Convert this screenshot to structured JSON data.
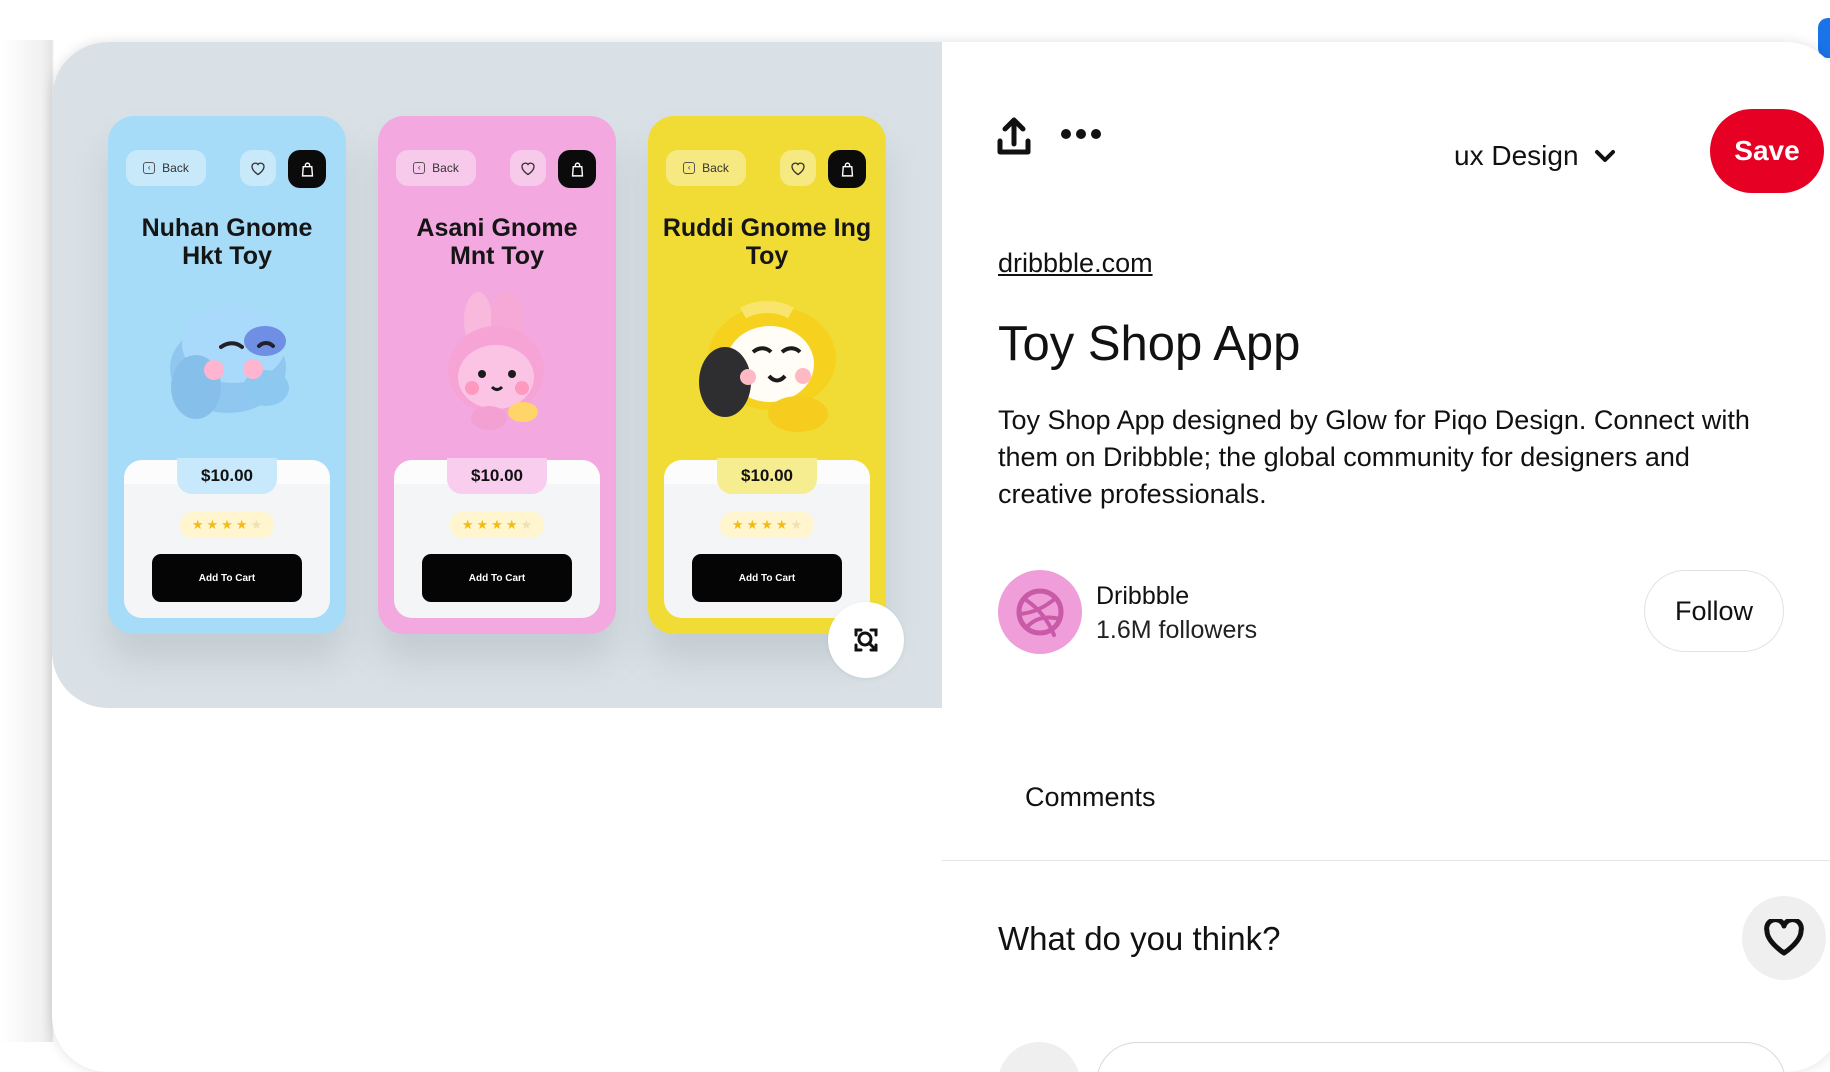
{
  "image": {
    "screens": [
      {
        "back_label": "Back",
        "title": "Nuhan Gnome Hkt Toy",
        "price": "$10.00",
        "rating": 4,
        "cart_label": "Add To Cart",
        "color": "#a6dcf7"
      },
      {
        "back_label": "Back",
        "title": "Asani Gnome Mnt Toy",
        "price": "$10.00",
        "rating": 4,
        "cart_label": "Add To Cart",
        "color": "#f3a8df"
      },
      {
        "back_label": "Back",
        "title": "Ruddi Gnome Ing Toy",
        "price": "$10.00",
        "rating": 4,
        "cart_label": "Add To Cart",
        "color": "#f1dc35"
      }
    ],
    "visual_search_icon": "visual-search-icon"
  },
  "toolbar": {
    "share_icon": "share-icon",
    "more_icon": "more-icon",
    "board_label": "ux Design",
    "save_label": "Save"
  },
  "pin": {
    "source_link": "dribbble.com",
    "title": "Toy Shop App",
    "description": "Toy Shop App designed by Glow for Piqo Design. Connect with them on Dribbble; the global community for designers and creative professionals."
  },
  "creator": {
    "name": "Dribbble",
    "followers": "1.6M followers",
    "follow_label": "Follow",
    "avatar_icon": "dribbble-icon"
  },
  "comments": {
    "heading": "Comments",
    "prompt": "What do you think?",
    "heart_icon": "heart-icon"
  },
  "colors": {
    "save": "#e60023",
    "text": "#111111",
    "image_background": "#d9e1e6"
  }
}
